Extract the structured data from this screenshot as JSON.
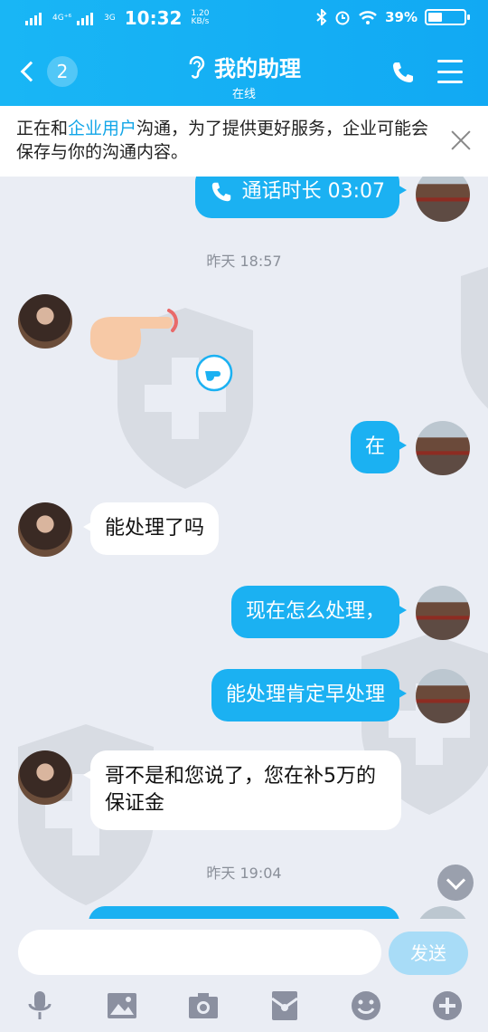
{
  "status_bar": {
    "network_1": "4G⁺⁶",
    "network_2": "3G",
    "time": "10:32",
    "speed_value": "1.20",
    "speed_unit": "KB/s",
    "battery": "39%",
    "battery_level": 0.39
  },
  "header": {
    "back_badge": "2",
    "title": "我的助理",
    "subtitle": "在线"
  },
  "notice": {
    "prefix": "正在和",
    "link": "企业用户",
    "suffix": "沟通，为了提供更好服务，企业可能会保存与你的沟通内容。"
  },
  "messages": {
    "call_duration": "通话时长 03:07",
    "time_1": "昨天 18:57",
    "reply_1": "在",
    "their_1": "能处理了吗",
    "reply_2": "现在怎么处理，",
    "reply_3": "能处理肯定早处理",
    "their_2": "哥不是和您说了，您在补5万的保证金",
    "time_2": "昨天 19:04"
  },
  "input": {
    "placeholder": "",
    "send_label": "发送"
  },
  "colors": {
    "header": "#13aef4",
    "bubble_me": "#1bb1f2",
    "background": "#eaedf4",
    "link": "#12a6e8"
  },
  "icons": {
    "status": [
      "signal-icon",
      "bluetooth-icon",
      "alarm-icon",
      "wifi-icon",
      "battery-icon"
    ],
    "toolbar": [
      "microphone-icon",
      "image-icon",
      "camera-icon",
      "red-packet-icon",
      "emoji-icon",
      "plus-icon"
    ]
  }
}
